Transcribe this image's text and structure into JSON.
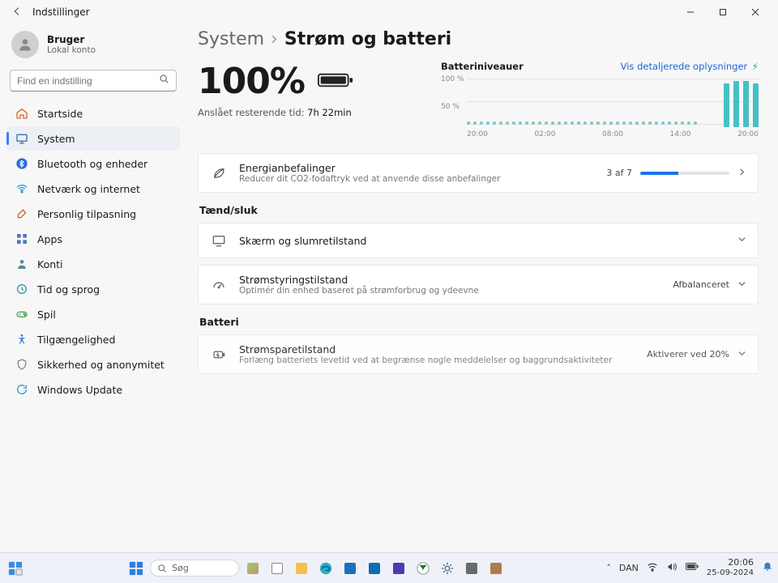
{
  "window": {
    "title": "Indstillinger"
  },
  "account": {
    "name": "Bruger",
    "sub": "Lokal konto"
  },
  "search": {
    "placeholder": "Find en indstilling"
  },
  "sidebar": {
    "items": [
      {
        "label": "Startside"
      },
      {
        "label": "System"
      },
      {
        "label": "Bluetooth og enheder"
      },
      {
        "label": "Netværk og internet"
      },
      {
        "label": "Personlig tilpasning"
      },
      {
        "label": "Apps"
      },
      {
        "label": "Konti"
      },
      {
        "label": "Tid og sprog"
      },
      {
        "label": "Spil"
      },
      {
        "label": "Tilgængelighed"
      },
      {
        "label": "Sikkerhed og anonymitet"
      },
      {
        "label": "Windows Update"
      }
    ],
    "active_index": 1
  },
  "breadcrumb": {
    "root": "System",
    "page": "Strøm og batteri"
  },
  "battery": {
    "percentage": "100%",
    "remaining_label": "Anslået resterende tid:",
    "remaining_value": "7h 22min"
  },
  "chart": {
    "title": "Batteriniveauer",
    "details_link": "Vis detaljerede oplysninger",
    "yticks": [
      "100 %",
      "50 %"
    ]
  },
  "chart_data": {
    "type": "bar",
    "title": "Batteriniveauer",
    "xlabel": "",
    "ylabel": "",
    "ylim": [
      0,
      100
    ],
    "xticks": [
      "20:00",
      "02:00",
      "08:00",
      "14:00",
      "20:00"
    ],
    "series": [
      {
        "name": "level_dots",
        "style": "dot",
        "values": [
          4,
          4,
          4,
          4,
          4,
          4,
          4,
          4,
          4,
          4,
          4,
          4,
          4,
          4,
          4,
          4,
          4,
          4,
          4,
          4,
          4,
          4,
          4,
          4,
          4,
          4,
          4,
          4,
          4,
          4,
          4,
          4,
          4,
          4,
          4,
          4
        ]
      },
      {
        "name": "recent_bars",
        "style": "bar",
        "values": [
          90,
          95,
          95,
          90
        ]
      }
    ]
  },
  "cards": {
    "energy": {
      "title": "Energianbefalinger",
      "sub": "Reducer dit CO2-fodaftryk ved at anvende disse anbefalinger",
      "count": "3 af 7",
      "progress_pct": 43
    },
    "section1": "Tænd/sluk",
    "screen": {
      "title": "Skærm og slumretilstand"
    },
    "powermode": {
      "title": "Strømstyringstilstand",
      "sub": "Optimér din enhed baseret på strømforbrug og ydeevne",
      "value": "Afbalanceret"
    },
    "section2": "Batteri",
    "saver": {
      "title": "Strømsparetilstand",
      "sub": "Forlæng batteriets levetid ved at begrænse nogle meddelelser og baggrundsaktiviteter",
      "value": "Aktiverer ved 20%"
    }
  },
  "taskbar": {
    "search": "Søg",
    "lang": "DAN",
    "time": "20:06",
    "date": "25-09-2024"
  }
}
